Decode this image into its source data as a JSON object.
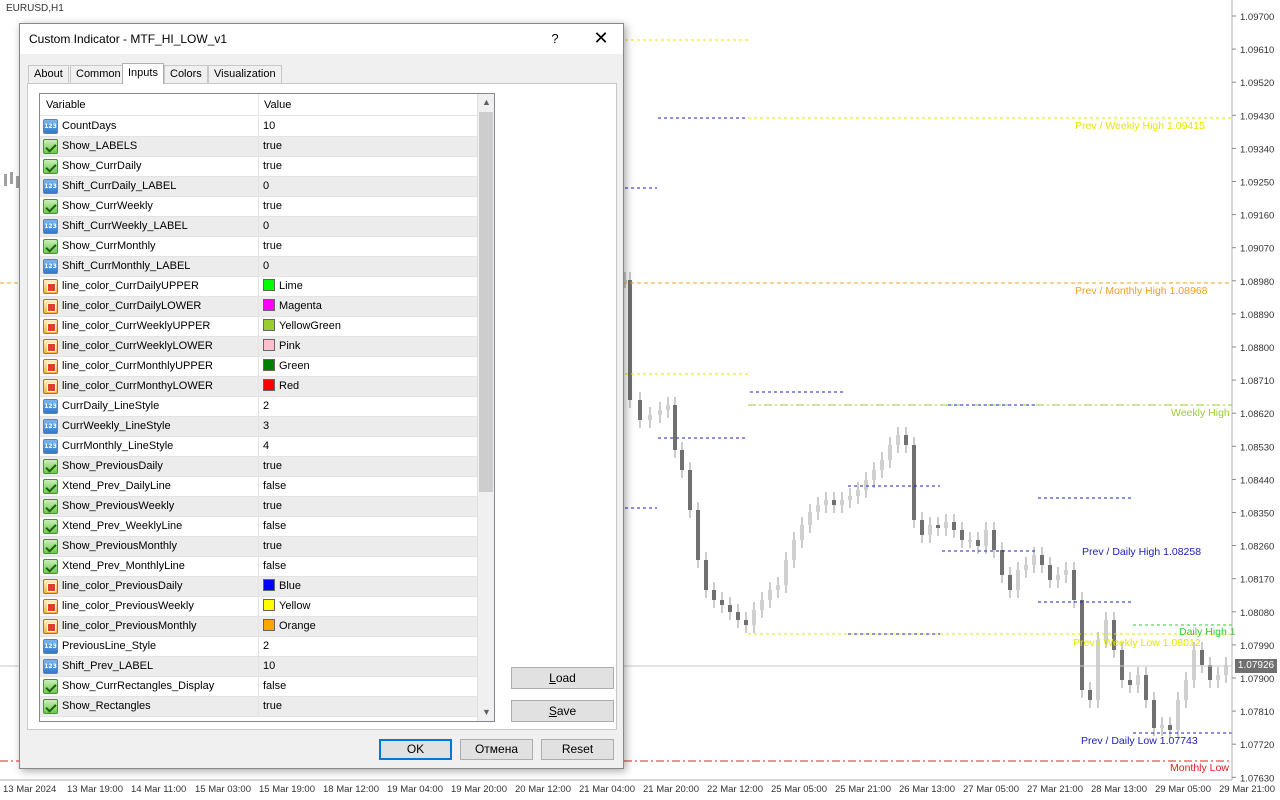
{
  "chart": {
    "symbol": "EURUSD,H1",
    "current_price": "1.07926",
    "price_ticks": [
      "1.09700",
      "1.09610",
      "1.09520",
      "1.09430",
      "1.09340",
      "1.09250",
      "1.09160",
      "1.09070",
      "1.08980",
      "1.08890",
      "1.08800",
      "1.08710",
      "1.08620",
      "1.08530",
      "1.08440",
      "1.08350",
      "1.08260",
      "1.08170",
      "1.08080",
      "1.07990",
      "1.07900",
      "1.07810",
      "1.07720",
      "1.07630"
    ],
    "time_ticks": [
      "13 Mar 2024",
      "13 Mar 19:00",
      "14 Mar 11:00",
      "15 Mar 03:00",
      "15 Mar 19:00",
      "18 Mar 12:00",
      "19 Mar 04:00",
      "19 Mar 20:00",
      "20 Mar 12:00",
      "21 Mar 04:00",
      "21 Mar 20:00",
      "22 Mar 12:00",
      "25 Mar 05:00",
      "25 Mar 21:00",
      "26 Mar 13:00",
      "27 Mar 05:00",
      "27 Mar 21:00",
      "28 Mar 13:00",
      "29 Mar 05:00",
      "29 Mar 21:00"
    ],
    "labels": [
      {
        "text": "Prev / Weekly High 1.09415",
        "color": "#e6e600"
      },
      {
        "text": "Prev / Monthly High 1.08968",
        "color": "#f0a020"
      },
      {
        "text": "Weekly High",
        "color": "#9acd32"
      },
      {
        "text": "Prev / Daily High 1.08258",
        "color": "#2020c0"
      },
      {
        "text": "Daily High 1",
        "color": "#32cd32"
      },
      {
        "text": "Prev / Weekly Low 1.08012",
        "color": "#e6e600"
      },
      {
        "text": "Prev / Daily Low 1.07743",
        "color": "#2020c0"
      },
      {
        "text": "Monthly Low",
        "color": "#e02020"
      }
    ]
  },
  "dialog": {
    "title": "Custom Indicator - MTF_HI_LOW_v1",
    "help": "?",
    "close": "✕",
    "tabs": [
      "About",
      "Common",
      "Inputs",
      "Colors",
      "Visualization"
    ],
    "active_tab": "Inputs",
    "columns": {
      "variable": "Variable",
      "value": "Value"
    },
    "rows": [
      {
        "type": "int",
        "variable": "CountDays",
        "value": "10"
      },
      {
        "type": "bool",
        "variable": "Show_LABELS",
        "value": "true"
      },
      {
        "type": "bool",
        "variable": "Show_CurrDaily",
        "value": "true"
      },
      {
        "type": "int",
        "variable": "Shift_CurrDaily_LABEL",
        "value": "0"
      },
      {
        "type": "bool",
        "variable": "Show_CurrWeekly",
        "value": "true"
      },
      {
        "type": "int",
        "variable": "Shift_CurrWeekly_LABEL",
        "value": "0"
      },
      {
        "type": "bool",
        "variable": "Show_CurrMonthly",
        "value": "true"
      },
      {
        "type": "int",
        "variable": "Shift_CurrMonthly_LABEL",
        "value": "0"
      },
      {
        "type": "color",
        "variable": "line_color_CurrDailyUPPER",
        "value": "Lime",
        "swatch": "#00ff00"
      },
      {
        "type": "color",
        "variable": "line_color_CurrDailyLOWER",
        "value": "Magenta",
        "swatch": "#ff00ff"
      },
      {
        "type": "color",
        "variable": "line_color_CurrWeeklyUPPER",
        "value": "YellowGreen",
        "swatch": "#9acd32"
      },
      {
        "type": "color",
        "variable": "line_color_CurrWeeklyLOWER",
        "value": "Pink",
        "swatch": "#ffc0cb"
      },
      {
        "type": "color",
        "variable": "line_color_CurrMonthlyUPPER",
        "value": "Green",
        "swatch": "#008000"
      },
      {
        "type": "color",
        "variable": "line_color_CurrMonthyLOWER",
        "value": "Red",
        "swatch": "#ff0000"
      },
      {
        "type": "int",
        "variable": "CurrDaily_LineStyle",
        "value": "2"
      },
      {
        "type": "int",
        "variable": "CurrWeekly_LineStyle",
        "value": "3"
      },
      {
        "type": "int",
        "variable": "CurrMonthly_LineStyle",
        "value": "4"
      },
      {
        "type": "bool",
        "variable": "Show_PreviousDaily",
        "value": "true"
      },
      {
        "type": "bool",
        "variable": "Xtend_Prev_DailyLine",
        "value": "false"
      },
      {
        "type": "bool",
        "variable": "Show_PreviousWeekly",
        "value": "true"
      },
      {
        "type": "bool",
        "variable": "Xtend_Prev_WeeklyLine",
        "value": "false"
      },
      {
        "type": "bool",
        "variable": "Show_PreviousMonthly",
        "value": "true"
      },
      {
        "type": "bool",
        "variable": "Xtend_Prev_MonthlyLine",
        "value": "false"
      },
      {
        "type": "color",
        "variable": "line_color_PreviousDaily",
        "value": "Blue",
        "swatch": "#0000ff"
      },
      {
        "type": "color",
        "variable": "line_color_PreviousWeekly",
        "value": "Yellow",
        "swatch": "#ffff00"
      },
      {
        "type": "color",
        "variable": "line_color_PreviousMonthly",
        "value": "Orange",
        "swatch": "#ffa500"
      },
      {
        "type": "int",
        "variable": "PreviousLine_Style",
        "value": "2"
      },
      {
        "type": "int",
        "variable": "Shift_Prev_LABEL",
        "value": "10"
      },
      {
        "type": "bool",
        "variable": "Show_CurrRectangles_Display",
        "value": "false"
      },
      {
        "type": "bool",
        "variable": "Show_Rectangles",
        "value": "true"
      }
    ],
    "buttons": {
      "load_u": "L",
      "load_rest": "oad",
      "save_u": "S",
      "save_rest": "ave",
      "ok": "OK",
      "cancel": "Отмена",
      "reset": "Reset"
    }
  }
}
